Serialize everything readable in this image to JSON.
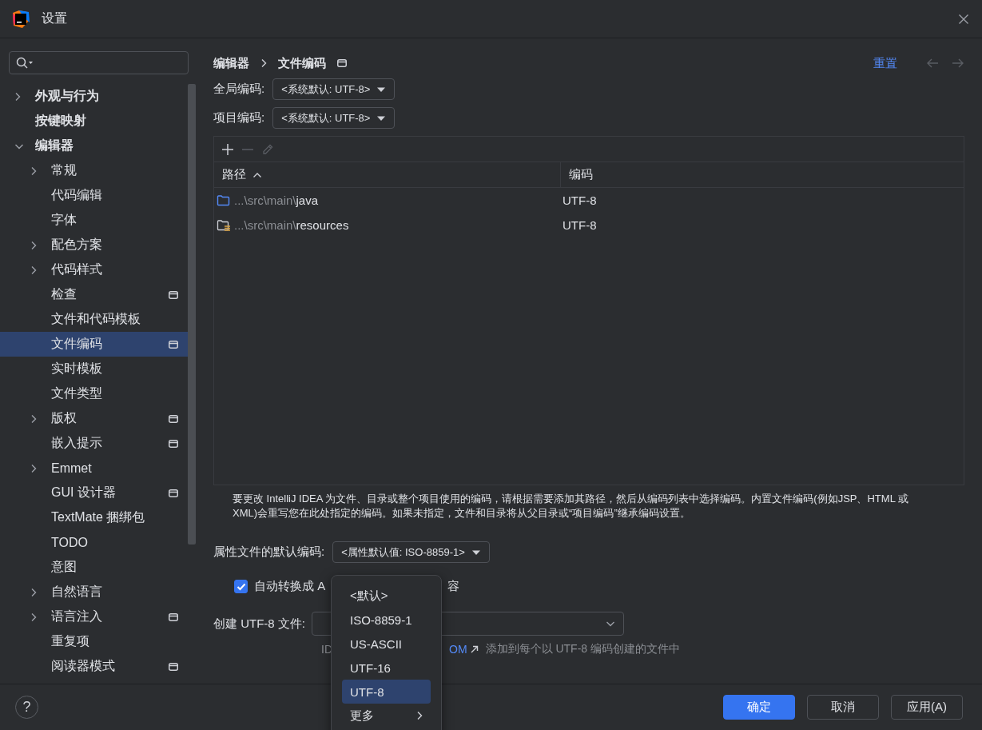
{
  "window": {
    "title": "设置"
  },
  "sidebar": {
    "items": [
      {
        "label": "外观与行为",
        "expanded": false,
        "selected": false,
        "scope_icon": false
      },
      {
        "label": "按键映射",
        "selected": false,
        "scope_icon": false
      },
      {
        "label": "编辑器",
        "expanded": true,
        "selected": false,
        "scope_icon": false,
        "children": [
          {
            "label": "常规",
            "expanded": false,
            "selected": false,
            "scope_icon": false
          },
          {
            "label": "代码编辑",
            "selected": false,
            "scope_icon": false
          },
          {
            "label": "字体",
            "selected": false,
            "scope_icon": false
          },
          {
            "label": "配色方案",
            "expanded": false,
            "selected": false,
            "scope_icon": false
          },
          {
            "label": "代码样式",
            "expanded": false,
            "selected": false,
            "scope_icon": false
          },
          {
            "label": "检查",
            "selected": false,
            "scope_icon": true
          },
          {
            "label": "文件和代码模板",
            "selected": false,
            "scope_icon": false
          },
          {
            "label": "文件编码",
            "selected": true,
            "scope_icon": true
          },
          {
            "label": "实时模板",
            "selected": false,
            "scope_icon": false
          },
          {
            "label": "文件类型",
            "selected": false,
            "scope_icon": false
          },
          {
            "label": "版权",
            "expanded": false,
            "selected": false,
            "scope_icon": true
          },
          {
            "label": "嵌入提示",
            "selected": false,
            "scope_icon": true
          },
          {
            "label": "Emmet",
            "expanded": false,
            "selected": false,
            "scope_icon": false
          },
          {
            "label": "GUI 设计器",
            "selected": false,
            "scope_icon": true
          },
          {
            "label": "TextMate 捆绑包",
            "selected": false,
            "scope_icon": false
          },
          {
            "label": "TODO",
            "selected": false,
            "scope_icon": false
          },
          {
            "label": "意图",
            "selected": false,
            "scope_icon": false
          },
          {
            "label": "自然语言",
            "expanded": false,
            "selected": false,
            "scope_icon": false
          },
          {
            "label": "语言注入",
            "expanded": false,
            "selected": false,
            "scope_icon": true
          },
          {
            "label": "重复项",
            "selected": false,
            "scope_icon": false
          },
          {
            "label": "阅读器模式",
            "selected": false,
            "scope_icon": true
          }
        ]
      }
    ]
  },
  "breadcrumb": {
    "items": [
      "编辑器",
      "文件编码"
    ],
    "scope_icon": true
  },
  "reset_link": "重置",
  "history": [
    {
      "kind": "back",
      "disabled": true
    },
    {
      "kind": "forward",
      "disabled": true
    }
  ],
  "global_encoding": {
    "label": "全局编码:",
    "value": "<系统默认: UTF-8>"
  },
  "project_encoding": {
    "label": "项目编码:",
    "value": "<系统默认: UTF-8>"
  },
  "table": {
    "toolbar": [
      {
        "kind": "add",
        "disabled": false
      },
      {
        "kind": "remove",
        "disabled": true
      },
      {
        "kind": "edit",
        "disabled": true
      }
    ],
    "columns": [
      {
        "label": "路径",
        "sorted": true
      },
      {
        "label": "编码",
        "sorted": false
      }
    ],
    "rows": [
      {
        "kind": "source",
        "path_prefix": "...\\src\\main\\",
        "path_name": "java",
        "encoding": "UTF-8"
      },
      {
        "kind": "resources",
        "path_prefix": "...\\src\\main\\",
        "path_name": "resources",
        "encoding": "UTF-8"
      }
    ]
  },
  "note": "要更改 IntelliJ IDEA 为文件、目录或整个项目使用的编码，请根据需要添加其路径，然后从编码列表中选择编码。内置文件编码(例如JSP、HTML 或 XML)会重写您在此处指定的编码。如果未指定，文件和目录将从父目录或“项目编码”继承编码设置。",
  "properties_encoding": {
    "label": "属性文件的默认编码:",
    "value": "<属性默认值: ISO-8859-1>"
  },
  "auto_convert": {
    "checked": true,
    "label": "自动转换成 A",
    "label_tail": "容"
  },
  "create_utf8": {
    "label": "创建 UTF-8 文件:"
  },
  "bom_hint": {
    "lead": "ID",
    "link": "OM",
    "text": "添加到每个以 UTF-8 编码创建的文件中"
  },
  "encoding_menu": {
    "items": [
      {
        "kind": "option",
        "label": "<默认>",
        "selected": false
      },
      {
        "kind": "option",
        "label": "ISO-8859-1",
        "selected": false
      },
      {
        "kind": "option",
        "label": "US-ASCII",
        "selected": false
      },
      {
        "kind": "option",
        "label": "UTF-16",
        "selected": false
      },
      {
        "kind": "option",
        "label": "UTF-8",
        "selected": true
      },
      {
        "kind": "submenu",
        "label": "更多",
        "selected": false
      }
    ]
  },
  "help": "?",
  "buttons": [
    {
      "kind": "primary",
      "label": "确定"
    },
    {
      "kind": "secondary",
      "label": "取消"
    },
    {
      "kind": "secondary",
      "label": "应用(A)"
    }
  ]
}
